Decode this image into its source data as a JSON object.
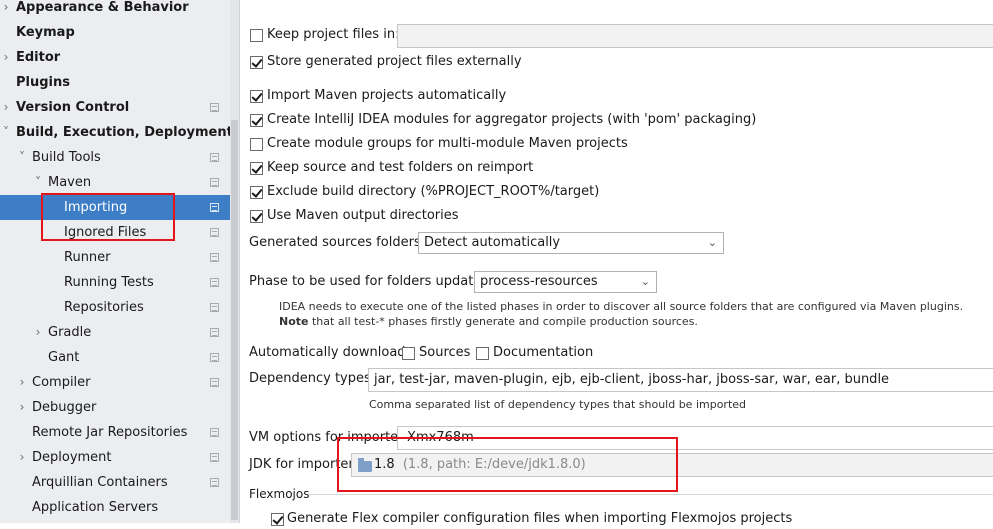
{
  "sidebar": {
    "items": [
      {
        "label": "Appearance & Behavior",
        "bold": true,
        "arrow": ">",
        "indent": 0,
        "cfg": false
      },
      {
        "label": "Keymap",
        "bold": true,
        "arrow": "",
        "indent": 0,
        "cfg": false
      },
      {
        "label": "Editor",
        "bold": true,
        "arrow": ">",
        "indent": 0,
        "cfg": false
      },
      {
        "label": "Plugins",
        "bold": true,
        "arrow": "",
        "indent": 0,
        "cfg": false
      },
      {
        "label": "Version Control",
        "bold": true,
        "arrow": ">",
        "indent": 0,
        "cfg": true
      },
      {
        "label": "Build, Execution, Deployment",
        "bold": true,
        "arrow": "v",
        "indent": 0,
        "cfg": false
      },
      {
        "label": "Build Tools",
        "bold": false,
        "arrow": "v",
        "indent": 1,
        "cfg": true
      },
      {
        "label": "Maven",
        "bold": false,
        "arrow": "v",
        "indent": 2,
        "cfg": true
      },
      {
        "label": "Importing",
        "bold": false,
        "arrow": "",
        "indent": 3,
        "cfg": true,
        "selected": true
      },
      {
        "label": "Ignored Files",
        "bold": false,
        "arrow": "",
        "indent": 3,
        "cfg": true
      },
      {
        "label": "Runner",
        "bold": false,
        "arrow": "",
        "indent": 3,
        "cfg": true
      },
      {
        "label": "Running Tests",
        "bold": false,
        "arrow": "",
        "indent": 3,
        "cfg": true
      },
      {
        "label": "Repositories",
        "bold": false,
        "arrow": "",
        "indent": 3,
        "cfg": true
      },
      {
        "label": "Gradle",
        "bold": false,
        "arrow": ">",
        "indent": 2,
        "cfg": true
      },
      {
        "label": "Gant",
        "bold": false,
        "arrow": "",
        "indent": 2,
        "cfg": true
      },
      {
        "label": "Compiler",
        "bold": false,
        "arrow": ">",
        "indent": 1,
        "cfg": true
      },
      {
        "label": "Debugger",
        "bold": false,
        "arrow": ">",
        "indent": 1,
        "cfg": false
      },
      {
        "label": "Remote Jar Repositories",
        "bold": false,
        "arrow": "",
        "indent": 1,
        "cfg": true
      },
      {
        "label": "Deployment",
        "bold": false,
        "arrow": ">",
        "indent": 1,
        "cfg": true
      },
      {
        "label": "Arquillian Containers",
        "bold": false,
        "arrow": "",
        "indent": 1,
        "cfg": true
      },
      {
        "label": "Application Servers",
        "bold": false,
        "arrow": "",
        "indent": 1,
        "cfg": false
      }
    ]
  },
  "settings": {
    "keep_project_files": {
      "label": "Keep project files in:",
      "checked": false,
      "value": ""
    },
    "store_externally": {
      "label": "Store generated project files externally",
      "checked": true
    },
    "import_auto": {
      "label": "Import Maven projects automatically",
      "checked": true
    },
    "create_modules": {
      "label": "Create IntelliJ IDEA modules for aggregator projects (with 'pom' packaging)",
      "checked": true
    },
    "create_groups": {
      "label": "Create module groups for multi-module Maven projects",
      "checked": false
    },
    "keep_source": {
      "label": "Keep source and test folders on reimport",
      "checked": true
    },
    "exclude_build": {
      "label": "Exclude build directory (%PROJECT_ROOT%/target)",
      "checked": true
    },
    "use_output": {
      "label": "Use Maven output directories",
      "checked": true
    },
    "generated_sources": {
      "label": "Generated sources folders:",
      "value": "Detect automatically"
    },
    "phase": {
      "label": "Phase to be used for folders update:",
      "value": "process-resources"
    },
    "phase_hint_1": "IDEA needs to execute one of the listed phases in order to discover all source folders that are configured via Maven plugins.",
    "phase_hint_note": "Note",
    "phase_hint_2": " that all test-* phases firstly generate and compile production sources.",
    "auto_download": {
      "label": "Automatically download:",
      "sources": "Sources",
      "documentation": "Documentation",
      "sources_checked": false,
      "documentation_checked": false
    },
    "dependency_types": {
      "label": "Dependency types:",
      "value": "jar, test-jar, maven-plugin, ejb, ejb-client, jboss-har, jboss-sar, war, ear, bundle",
      "hint": "Comma separated list of dependency types that should be imported"
    },
    "vm_options": {
      "label": "VM options for importer:",
      "value": "-Xmx768m"
    },
    "jdk": {
      "label": "JDK for importer:",
      "value": "1.8",
      "detail": "(1.8, path: E:/deve/jdk1.8.0)"
    },
    "flexmojos": {
      "title": "Flexmojos",
      "generate": "Generate Flex compiler configuration files when importing Flexmojos projects",
      "generate_checked": true
    }
  },
  "colors": {
    "highlight": "#e4141b",
    "selection": "#3e7ec6"
  }
}
